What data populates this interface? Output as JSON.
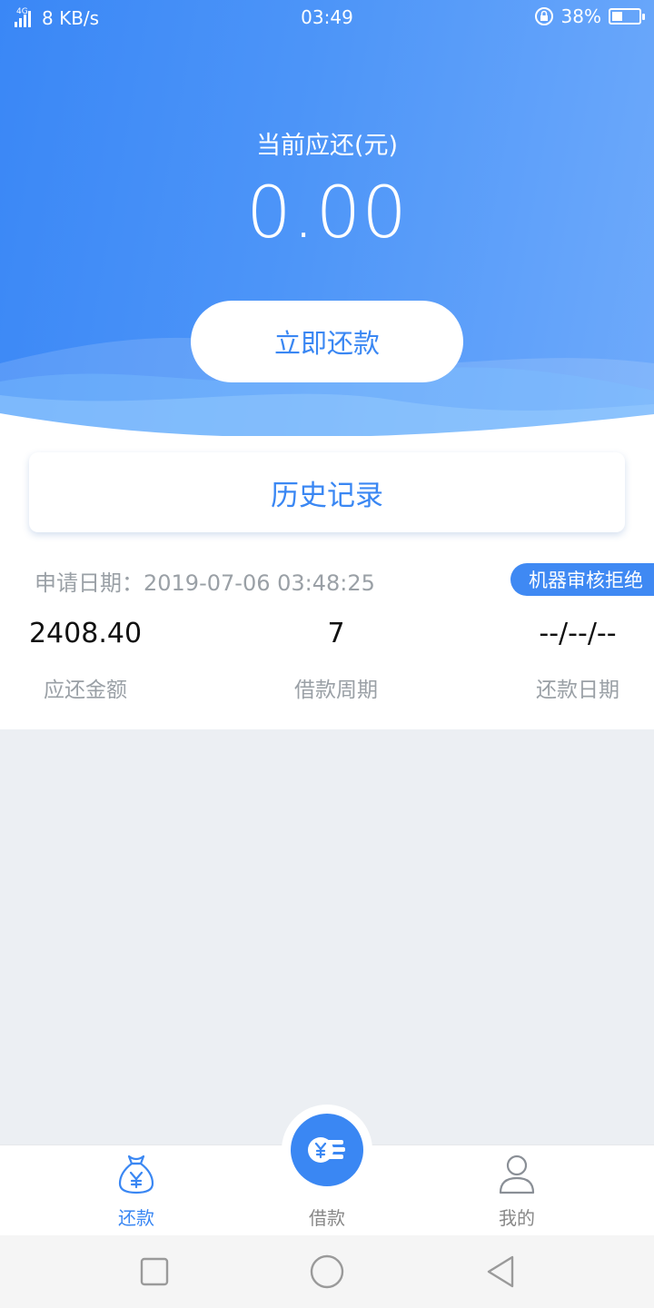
{
  "status_bar": {
    "network_type": "4G",
    "speed": "8 KB/s",
    "time": "03:49",
    "battery": "38%",
    "battery_level": 0.38
  },
  "hero": {
    "due_label": "当前应还(元)",
    "due_amount": "0.00",
    "repay_button": "立即还款"
  },
  "history_button": "历史记录",
  "record": {
    "apply_label": "申请日期：",
    "apply_date": "2019-07-06 03:48:25",
    "status": "机器审核拒绝",
    "stats": [
      {
        "value": "2408.40",
        "label": "应还金额"
      },
      {
        "value": "7",
        "label": "借款周期"
      },
      {
        "value": "--/--/--",
        "label": "还款日期"
      }
    ]
  },
  "tabbar": {
    "tabs": [
      {
        "label": "还款",
        "icon": "money-bag-icon",
        "active": true
      },
      {
        "label": "借款",
        "icon": "coin-stack-icon",
        "active": false
      },
      {
        "label": "我的",
        "icon": "user-icon",
        "active": false
      }
    ]
  },
  "colors": {
    "accent": "#3a87f3",
    "hero_start": "#3a87f6",
    "hero_end": "#6eaafb",
    "muted_text": "#9aa0a6",
    "page_bg": "#eceff3"
  },
  "system_nav": [
    "square-recents-icon",
    "circle-home-icon",
    "triangle-back-icon"
  ]
}
